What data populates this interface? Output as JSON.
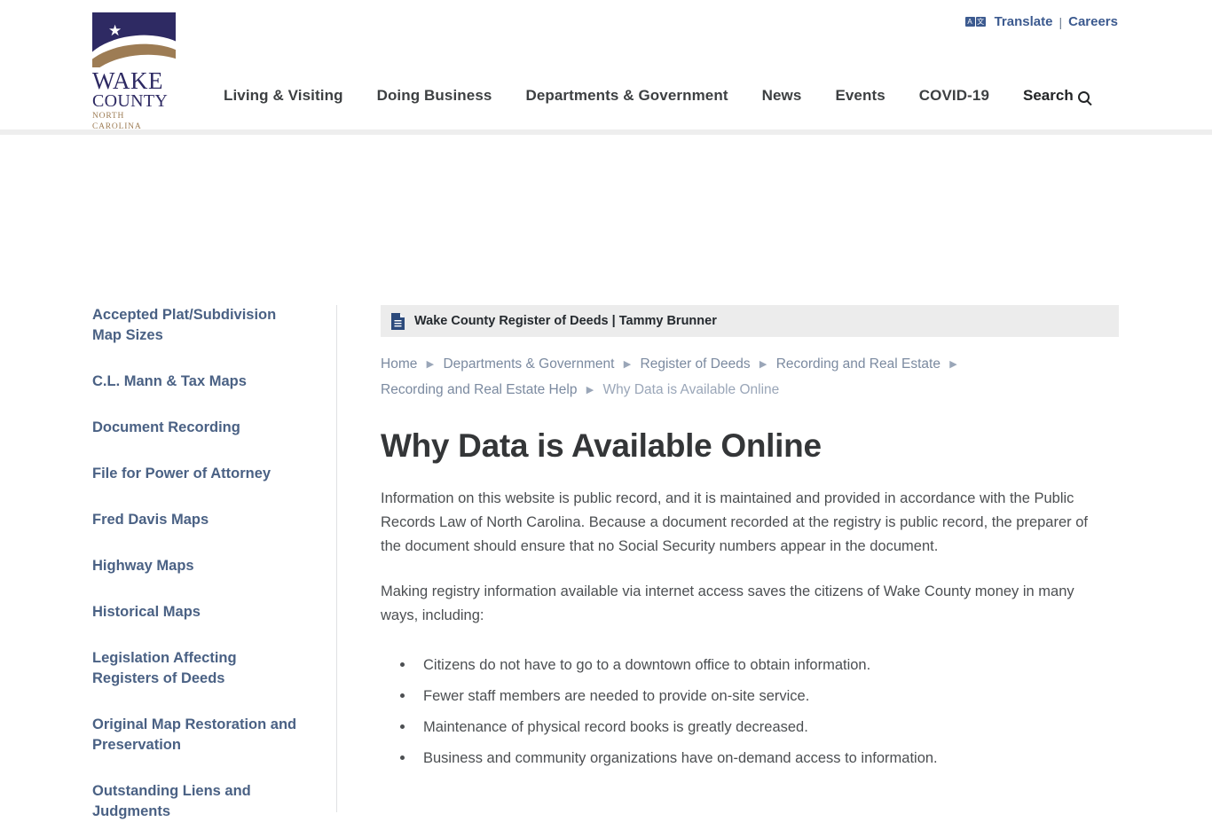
{
  "header": {
    "logo": {
      "line1": "WAKE",
      "line2": "COUNTY",
      "line3": "NORTH CAROLINA",
      "star": "★"
    },
    "utility": {
      "translate_label": "Translate",
      "translate_icon_a": "A",
      "translate_icon_b": "文",
      "separator": "|",
      "careers_label": "Careers"
    },
    "nav": [
      {
        "label": "Living & Visiting"
      },
      {
        "label": "Doing Business"
      },
      {
        "label": "Departments & Government"
      },
      {
        "label": "News"
      },
      {
        "label": "Events"
      },
      {
        "label": "COVID-19"
      }
    ],
    "search_label": "Search"
  },
  "sidebar": {
    "items": [
      {
        "label": "Accepted Plat/Subdivision Map Sizes"
      },
      {
        "label": "C.L. Mann & Tax Maps"
      },
      {
        "label": "Document Recording"
      },
      {
        "label": "File for Power of Attorney"
      },
      {
        "label": "Fred Davis Maps"
      },
      {
        "label": "Highway Maps"
      },
      {
        "label": "Historical Maps"
      },
      {
        "label": "Legislation Affecting Registers of Deeds"
      },
      {
        "label": "Original Map Restoration and Preservation"
      },
      {
        "label": "Outstanding Liens and Judgments"
      }
    ]
  },
  "main": {
    "department_banner": "Wake County Register of Deeds | Tammy Brunner",
    "breadcrumb": [
      {
        "label": "Home",
        "current": false
      },
      {
        "label": "Departments & Government",
        "current": false
      },
      {
        "label": "Register of Deeds",
        "current": false
      },
      {
        "label": "Recording and Real Estate",
        "current": false
      },
      {
        "label": "Recording and Real Estate Help",
        "current": false
      },
      {
        "label": "Why Data is Available Online",
        "current": true
      }
    ],
    "breadcrumb_separator": "▶",
    "title": "Why Data is Available Online",
    "paragraphs": [
      "Information on this website is public record, and it is maintained and provided in accordance with the Public Records Law of North Carolina. Because a document recorded at the registry is public record, the preparer of the document should ensure that no Social Security numbers appear in the document.",
      "Making registry information available via internet access saves the citizens of Wake County money in many ways, including:"
    ],
    "bullets": [
      "Citizens do not have to go to a downtown office to obtain information.",
      "Fewer staff members are needed to provide on-site service.",
      "Maintenance of physical record books is greatly decreased.",
      "Business and community organizations have on-demand access to information."
    ]
  },
  "colors": {
    "navy": "#2e2a63",
    "tan": "#9d7c54",
    "link_blue": "#4a6184",
    "utility_blue": "#3c5a8f",
    "banner_gray": "#ececec"
  }
}
